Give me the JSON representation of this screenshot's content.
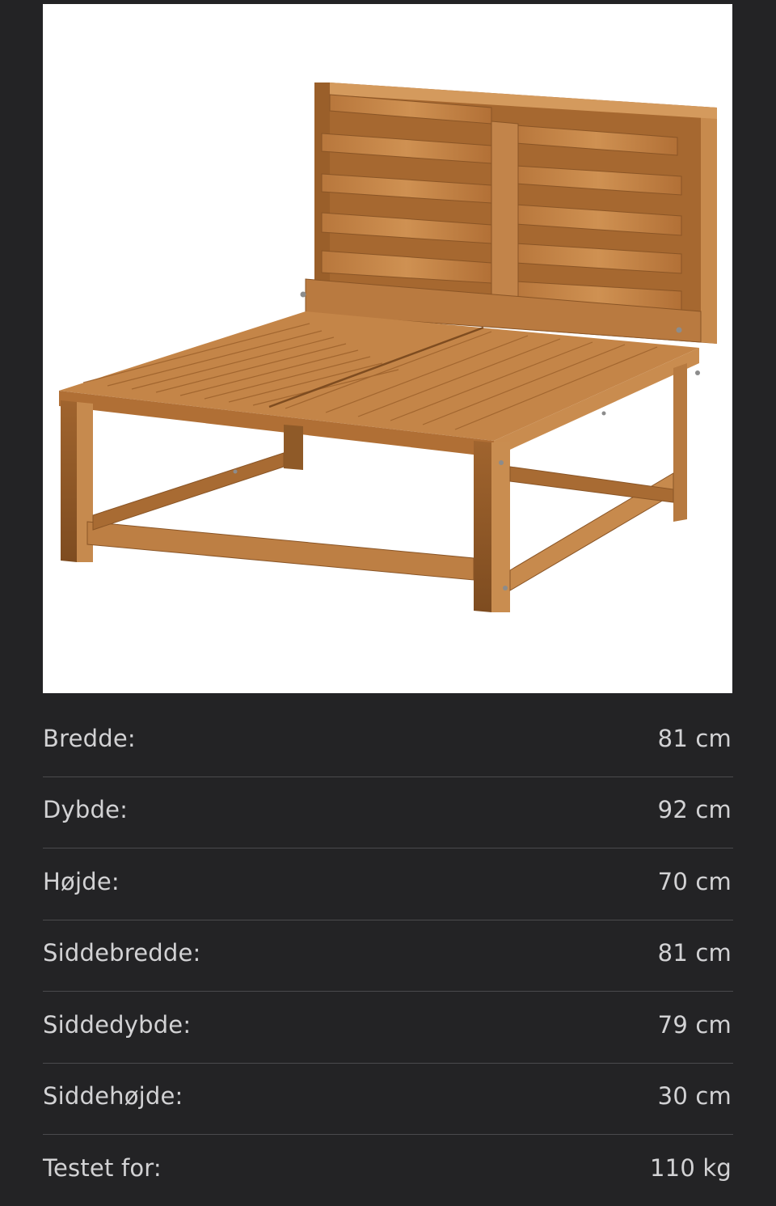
{
  "product_image": {
    "alt": "",
    "colors": {
      "wood_light": "#c98a4a",
      "wood_mid": "#b0743a",
      "wood_dark": "#8a5526",
      "background": "#ffffff"
    }
  },
  "specs": [
    {
      "label": "Bredde:",
      "value": "81 cm"
    },
    {
      "label": "Dybde:",
      "value": "92 cm"
    },
    {
      "label": "Højde:",
      "value": "70 cm"
    },
    {
      "label": "Siddebredde:",
      "value": "81 cm"
    },
    {
      "label": "Siddedybde:",
      "value": "79 cm"
    },
    {
      "label": "Siddehøjde:",
      "value": "30 cm"
    },
    {
      "label": "Testet for:",
      "value": "110 kg"
    }
  ]
}
